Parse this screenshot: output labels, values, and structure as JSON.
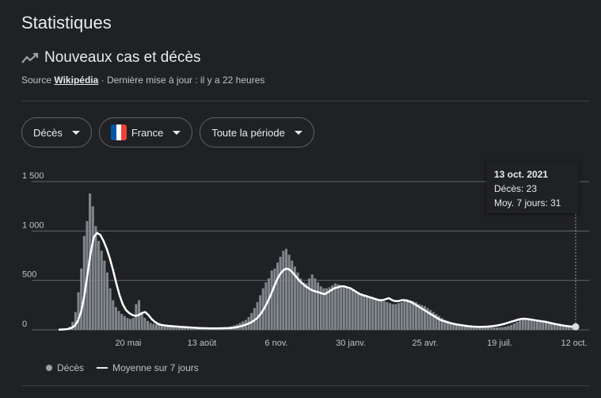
{
  "page_title": "Statistiques",
  "section": {
    "title": "Nouveaux cas et décès",
    "icon": "trending-icon"
  },
  "source": {
    "prefix": "Source",
    "link": "Wikipédia",
    "updated": " · Dernière mise à jour : il y a 22 heures"
  },
  "filters": {
    "metric": "Décès",
    "country": "France",
    "period": "Toute la période"
  },
  "tooltip": {
    "date": "13 oct. 2021",
    "deaths": "Décès: 23",
    "avg": "Moy. 7 jours: 31"
  },
  "legend": {
    "bars": "Décès",
    "line": "Moyenne sur 7 jours"
  },
  "colors": {
    "bars": "#80868b",
    "line": "#ffffff",
    "grid": "#5f6368",
    "flag_blue": "#0055a4",
    "flag_white": "#ffffff",
    "flag_red": "#ef4135"
  },
  "chart_data": {
    "type": "bar",
    "ylim": [
      0,
      1500
    ],
    "y_ticks": [
      "0",
      "500",
      "1 000",
      "1 500"
    ],
    "x_ticks": [
      "20 mai",
      "13 août",
      "6 nov.",
      "30 janv.",
      "25 avr.",
      "19 juil.",
      "12 oct."
    ],
    "series": [
      {
        "name": "Décès",
        "values": [
          2,
          4,
          8,
          15,
          30,
          80,
          180,
          380,
          620,
          950,
          1100,
          1380,
          1250,
          1050,
          900,
          800,
          700,
          580,
          420,
          300,
          230,
          190,
          160,
          140,
          120,
          110,
          120,
          260,
          300,
          180,
          120,
          90,
          70,
          60,
          55,
          50,
          45,
          40,
          40,
          35,
          32,
          30,
          28,
          26,
          25,
          24,
          22,
          20,
          18,
          17,
          16,
          15,
          15,
          14,
          15,
          16,
          18,
          20,
          22,
          28,
          35,
          45,
          55,
          70,
          85,
          100,
          130,
          170,
          220,
          280,
          350,
          420,
          480,
          520,
          600,
          620,
          680,
          740,
          800,
          820,
          760,
          700,
          640,
          580,
          520,
          480,
          470,
          520,
          560,
          520,
          480,
          440,
          420,
          420,
          430,
          450,
          470,
          460,
          440,
          430,
          420,
          410,
          400,
          390,
          380,
          370,
          360,
          350,
          340,
          330,
          320,
          310,
          300,
          290,
          280,
          270,
          260,
          260,
          270,
          280,
          300,
          310,
          300,
          290,
          280,
          260,
          250,
          240,
          220,
          200,
          180,
          160,
          140,
          120,
          100,
          90,
          80,
          70,
          65,
          60,
          55,
          50,
          45,
          40,
          38,
          35,
          32,
          30,
          28,
          26,
          25,
          24,
          24,
          25,
          28,
          32,
          40,
          50,
          65,
          80,
          95,
          105,
          110,
          110,
          105,
          100,
          95,
          90,
          85,
          80,
          70,
          60,
          55,
          50,
          40,
          35,
          30,
          28,
          25,
          23
        ]
      },
      {
        "name": "Moyenne sur 7 jours",
        "values": [
          2,
          3,
          5,
          10,
          20,
          40,
          90,
          180,
          340,
          560,
          780,
          940,
          980,
          960,
          900,
          820,
          720,
          600,
          470,
          350,
          260,
          200,
          170,
          150,
          140,
          150,
          170,
          180,
          150,
          110,
          80,
          60,
          50,
          45,
          40,
          38,
          35,
          33,
          30,
          28,
          26,
          24,
          22,
          20,
          18,
          17,
          16,
          15,
          15,
          15,
          15,
          16,
          17,
          18,
          20,
          24,
          30,
          38,
          48,
          60,
          75,
          95,
          120,
          160,
          210,
          270,
          340,
          420,
          500,
          560,
          600,
          620,
          610,
          580,
          540,
          500,
          470,
          440,
          420,
          400,
          390,
          380,
          370,
          360,
          380,
          400,
          420,
          430,
          440,
          440,
          430,
          420,
          400,
          380,
          360,
          350,
          340,
          330,
          320,
          310,
          300,
          300,
          310,
          320,
          300,
          290,
          290,
          300,
          300,
          290,
          280,
          260,
          240,
          220,
          200,
          180,
          160,
          140,
          120,
          100,
          90,
          80,
          70,
          62,
          55,
          50,
          45,
          40,
          36,
          33,
          31,
          30,
          30,
          31,
          33,
          36,
          40,
          45,
          52,
          60,
          70,
          80,
          90,
          100,
          108,
          112,
          110,
          105,
          100,
          95,
          90,
          85,
          80,
          72,
          65,
          58,
          52,
          46,
          40,
          36,
          33,
          31
        ]
      }
    ]
  }
}
